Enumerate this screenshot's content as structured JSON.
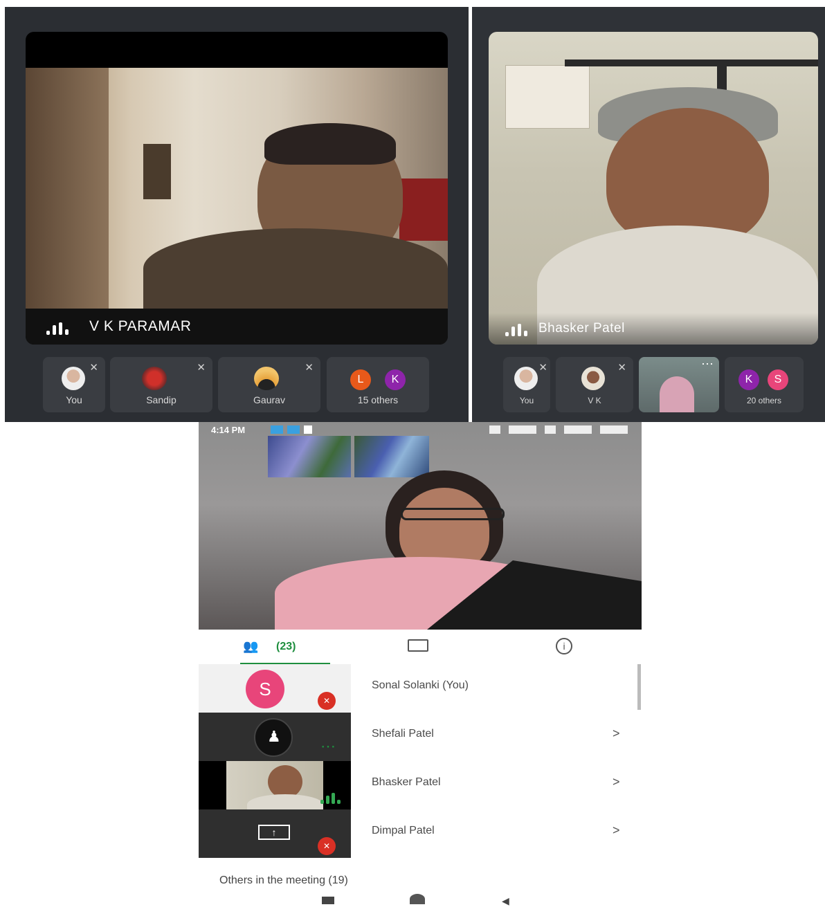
{
  "left_meeting": {
    "speaker_name": "V K PARAMAR",
    "tiles": [
      {
        "label": "You"
      },
      {
        "label": "Sandip"
      },
      {
        "label": "Gaurav"
      },
      {
        "label": "15 others",
        "chips": [
          "L",
          "K"
        ]
      }
    ]
  },
  "right_meeting": {
    "speaker_name": "Bhasker Patel",
    "tiles": [
      {
        "label": "You"
      },
      {
        "label": "V K"
      },
      {
        "label": ""
      },
      {
        "label": "20 others",
        "chips": [
          "K",
          "S"
        ]
      }
    ]
  },
  "phone": {
    "status_time": "4:14 PM",
    "tabs": {
      "people_count": "(23)"
    },
    "participants": [
      {
        "name": "Sonal Solanki (You)",
        "avatar_letter": "S",
        "chevron": ""
      },
      {
        "name": "Shefali Patel",
        "chevron": ">"
      },
      {
        "name": "Bhasker Patel",
        "chevron": ">"
      },
      {
        "name": "Dimpal Patel",
        "chevron": ">"
      }
    ],
    "others_label": "Others in the meeting (19)"
  },
  "colors": {
    "panel_bg": "#2b2e33",
    "tile_bg": "#3a3d42",
    "accent_green": "#1e8e3e",
    "avatar_pink": "#e8457a",
    "chip_orange": "#e8591a",
    "chip_purple": "#8e24aa",
    "mute_red": "#d93025"
  }
}
